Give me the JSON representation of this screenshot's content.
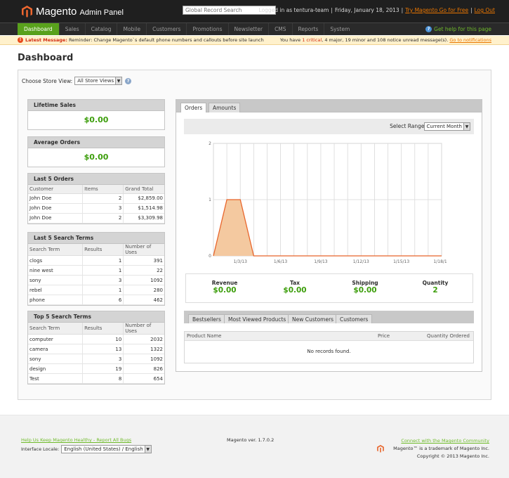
{
  "header": {
    "brand": "Magento",
    "brand_sub": "Admin Panel",
    "global_search_placeholder": "Global Record Search",
    "logged_in": "Logged in as tentura-team",
    "date": "Friday, January 18, 2013",
    "try_link": "Try Magento Go for Free",
    "logout": "Log Out"
  },
  "nav": {
    "items": [
      "Dashboard",
      "Sales",
      "Catalog",
      "Mobile",
      "Customers",
      "Promotions",
      "Newsletter",
      "CMS",
      "Reports",
      "System"
    ],
    "help": "Get help for this page"
  },
  "message": {
    "label": "Latest Message:",
    "text": "Reminder: Change Magento`s default phone numbers and callouts before site launch",
    "right_prefix": "You have",
    "critical": "1 critical",
    "right_rest": ", 4 major, 19 minor and 108 notice unread message(s).",
    "link": "Go to notifications"
  },
  "page_title": "Dashboard",
  "store_view": {
    "label": "Choose Store View:",
    "value": "All Store Views"
  },
  "lifetime_sales": {
    "title": "Lifetime Sales",
    "value": "$0.00"
  },
  "average_orders": {
    "title": "Average Orders",
    "value": "$0.00"
  },
  "last_orders": {
    "title": "Last 5 Orders",
    "columns": [
      "Customer",
      "Items",
      "Grand Total"
    ],
    "rows": [
      [
        "John Doe",
        "2",
        "$2,859.00"
      ],
      [
        "John Doe",
        "3",
        "$1,514.98"
      ],
      [
        "John Doe",
        "2",
        "$3,309.98"
      ]
    ]
  },
  "last_search": {
    "title": "Last 5 Search Terms",
    "columns": [
      "Search Term",
      "Results",
      "Number of Uses"
    ],
    "rows": [
      [
        "clogs",
        "1",
        "391"
      ],
      [
        "nine west",
        "1",
        "22"
      ],
      [
        "sony",
        "3",
        "1092"
      ],
      [
        "rebel",
        "1",
        "280"
      ],
      [
        "phone",
        "6",
        "462"
      ]
    ]
  },
  "top_search": {
    "title": "Top 5 Search Terms",
    "columns": [
      "Search Term",
      "Results",
      "Number of Uses"
    ],
    "rows": [
      [
        "computer",
        "10",
        "2032"
      ],
      [
        "camera",
        "13",
        "1322"
      ],
      [
        "sony",
        "3",
        "1092"
      ],
      [
        "design",
        "19",
        "826"
      ],
      [
        "Test",
        "8",
        "654"
      ]
    ]
  },
  "chart_tabs": [
    "Orders",
    "Amounts"
  ],
  "range": {
    "label": "Select Range:",
    "value": "Current Month"
  },
  "chart_data": {
    "type": "area",
    "x": [
      "1/1/13",
      "1/2/13",
      "1/3/13",
      "1/4/13",
      "1/5/13",
      "1/6/13",
      "1/7/13",
      "1/8/13",
      "1/9/13",
      "1/10/13",
      "1/11/13",
      "1/12/13",
      "1/13/13",
      "1/14/13",
      "1/15/13",
      "1/16/13",
      "1/17/13",
      "1/18/13"
    ],
    "values": [
      0,
      1,
      1,
      0,
      0,
      0,
      0,
      0,
      0,
      0,
      0,
      0,
      0,
      0,
      0,
      0,
      0,
      0
    ],
    "x_tick_labels": [
      "1/3/13",
      "1/6/13",
      "1/9/13",
      "1/12/13",
      "1/15/13",
      "1/18/13"
    ],
    "y_ticks": [
      "0",
      "1",
      "2"
    ],
    "ylim": [
      0,
      2
    ],
    "grid": true,
    "fill_color": "#f4c9a0",
    "line_color": "#e8652b"
  },
  "totals": [
    {
      "label": "Revenue",
      "value": "$0.00"
    },
    {
      "label": "Tax",
      "value": "$0.00"
    },
    {
      "label": "Shipping",
      "value": "$0.00"
    },
    {
      "label": "Quantity",
      "value": "2"
    }
  ],
  "product_tabs": [
    "Bestsellers",
    "Most Viewed Products",
    "New Customers",
    "Customers"
  ],
  "product_table": {
    "columns": [
      "Product Name",
      "Price",
      "Quantity Ordered"
    ],
    "empty": "No records found."
  },
  "footer": {
    "help_link": "Help Us Keep Magento Healthy - Report All Bugs",
    "locale_label": "Interface Locale:",
    "locale_value": "English (United States) / English",
    "version": "Magento ver. 1.7.0.2",
    "community_link": "Connect with the Magento Community",
    "trademark": "Magento™ is a trademark of Magento Inc.",
    "copyright": "Copyright © 2013 Magento Inc."
  }
}
